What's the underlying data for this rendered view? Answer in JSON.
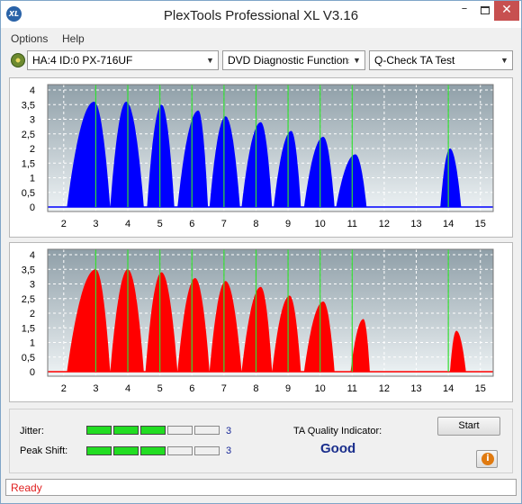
{
  "window": {
    "title": "PlexTools Professional XL V3.16",
    "app_icon": "XL",
    "minimize": "–",
    "close": "✕"
  },
  "menu": [
    "Options",
    "Help"
  ],
  "toolbar": {
    "drive": "HA:4 ID:0  PX-716UF",
    "function": "DVD Diagnostic Functions",
    "test": "Q-Check TA Test"
  },
  "charts": {
    "y_ticks": [
      "4",
      "3,5",
      "3",
      "2,5",
      "2",
      "1,5",
      "1",
      "0,5",
      "0"
    ],
    "x_ticks": [
      "2",
      "3",
      "4",
      "5",
      "6",
      "7",
      "8",
      "9",
      "10",
      "11",
      "12",
      "13",
      "14",
      "15"
    ],
    "marker_color": "#33dd33",
    "plot_bg_top": "#8f9fa8",
    "plot_bg_bottom": "#eef3f5"
  },
  "chart_data": [
    {
      "type": "area",
      "color": "#0000ff",
      "ylim": [
        0,
        4
      ],
      "xlim": [
        1.5,
        15.4
      ],
      "markers": [
        3,
        4,
        5,
        6,
        7,
        8,
        9,
        10,
        11,
        14
      ],
      "peaks": [
        {
          "start": 2.1,
          "end": 3.45,
          "center": 2.95,
          "height": 3.6
        },
        {
          "start": 3.45,
          "end": 4.5,
          "center": 3.95,
          "height": 3.6
        },
        {
          "start": 4.6,
          "end": 5.45,
          "center": 5.05,
          "height": 3.5
        },
        {
          "start": 5.55,
          "end": 6.5,
          "center": 6.2,
          "height": 3.3
        },
        {
          "start": 6.55,
          "end": 7.5,
          "center": 7.05,
          "height": 3.1
        },
        {
          "start": 7.55,
          "end": 8.5,
          "center": 8.15,
          "height": 2.9
        },
        {
          "start": 8.55,
          "end": 9.4,
          "center": 9.1,
          "height": 2.6
        },
        {
          "start": 9.5,
          "end": 10.45,
          "center": 10.1,
          "height": 2.4
        },
        {
          "start": 10.5,
          "end": 11.45,
          "center": 11.1,
          "height": 1.8
        },
        {
          "start": 13.75,
          "end": 14.4,
          "center": 14.05,
          "height": 2.0
        }
      ]
    },
    {
      "type": "area",
      "color": "#ff0000",
      "ylim": [
        0,
        4
      ],
      "xlim": [
        1.5,
        15.4
      ],
      "markers": [
        3,
        4,
        5,
        6,
        7,
        8,
        9,
        10,
        11,
        14
      ],
      "peaks": [
        {
          "start": 2.1,
          "end": 3.45,
          "center": 3.0,
          "height": 3.5
        },
        {
          "start": 3.45,
          "end": 4.5,
          "center": 4.0,
          "height": 3.5
        },
        {
          "start": 4.55,
          "end": 5.55,
          "center": 5.05,
          "height": 3.4
        },
        {
          "start": 5.55,
          "end": 6.55,
          "center": 6.1,
          "height": 3.2
        },
        {
          "start": 6.55,
          "end": 7.55,
          "center": 7.05,
          "height": 3.1
        },
        {
          "start": 7.55,
          "end": 8.5,
          "center": 8.15,
          "height": 2.9
        },
        {
          "start": 8.5,
          "end": 9.4,
          "center": 9.05,
          "height": 2.6
        },
        {
          "start": 9.5,
          "end": 10.45,
          "center": 10.1,
          "height": 2.4
        },
        {
          "start": 10.95,
          "end": 11.55,
          "center": 11.35,
          "height": 1.8
        },
        {
          "start": 14.05,
          "end": 14.55,
          "center": 14.25,
          "height": 1.4
        }
      ]
    }
  ],
  "results": {
    "jitter_label": "Jitter:",
    "jitter_level": 3,
    "jitter_max": 5,
    "jitter_value": "3",
    "peak_shift_label": "Peak Shift:",
    "peak_shift_level": 3,
    "peak_shift_max": 5,
    "peak_shift_value": "3",
    "ta_quality_label": "TA Quality Indicator:",
    "ta_quality_value": "Good",
    "start_label": "Start",
    "info_icon": "i"
  },
  "status": {
    "text": "Ready"
  }
}
